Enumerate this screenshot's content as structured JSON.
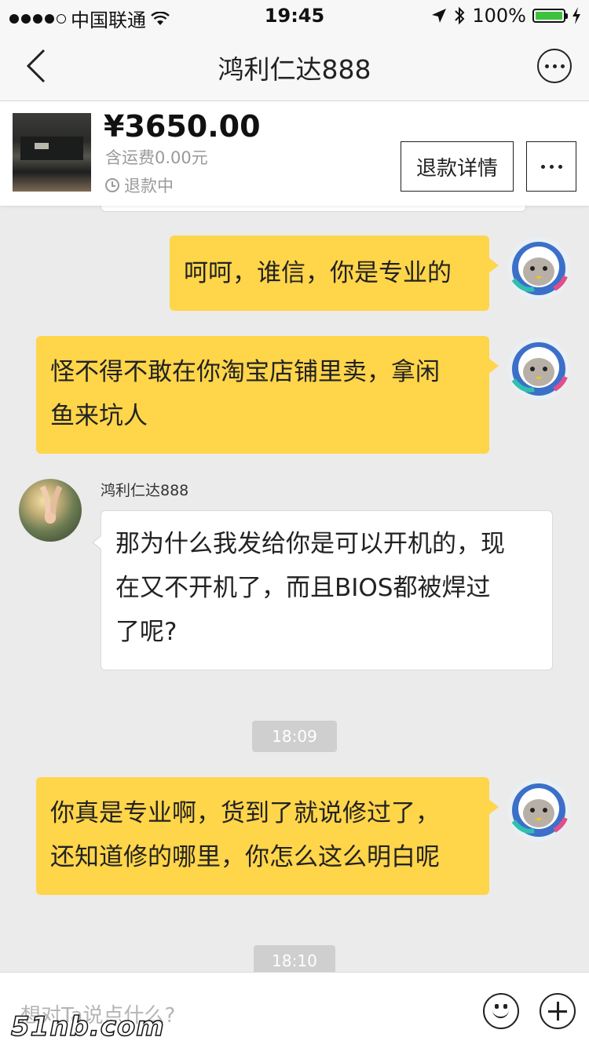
{
  "status_bar": {
    "carrier": "中国联通",
    "time": "19:45",
    "battery": "100%"
  },
  "nav": {
    "title": "鸿利仁达888"
  },
  "product": {
    "price": "¥3650.00",
    "shipping": "含运费0.00元",
    "status": "退款中",
    "refund_button": "退款详情"
  },
  "messages": [
    {
      "side": "right",
      "text": "呵呵，谁信，你是专业的"
    },
    {
      "side": "right",
      "text_lines": [
        "怪不得不敢在你淘宝店铺里卖，拿闲",
        "鱼来坑人"
      ]
    },
    {
      "side": "left",
      "sender": "鸿利仁达888",
      "text_lines": [
        "那为什么我发给你是可以开机的，现",
        "在又不开机了，而且BIOS都被焊过",
        "了呢?"
      ]
    },
    {
      "type": "time",
      "text": "18:09"
    },
    {
      "side": "right",
      "text_lines": [
        "你真是专业啊，货到了就说修过了，",
        "还知道修的哪里，你怎么这么明白呢"
      ]
    },
    {
      "type": "time",
      "text": "18:10"
    }
  ],
  "input": {
    "placeholder": "想对Ta说点什么?"
  },
  "watermark": "51nb.com",
  "colors": {
    "my_bubble": "#ffd54a",
    "background": "#ebebeb"
  }
}
